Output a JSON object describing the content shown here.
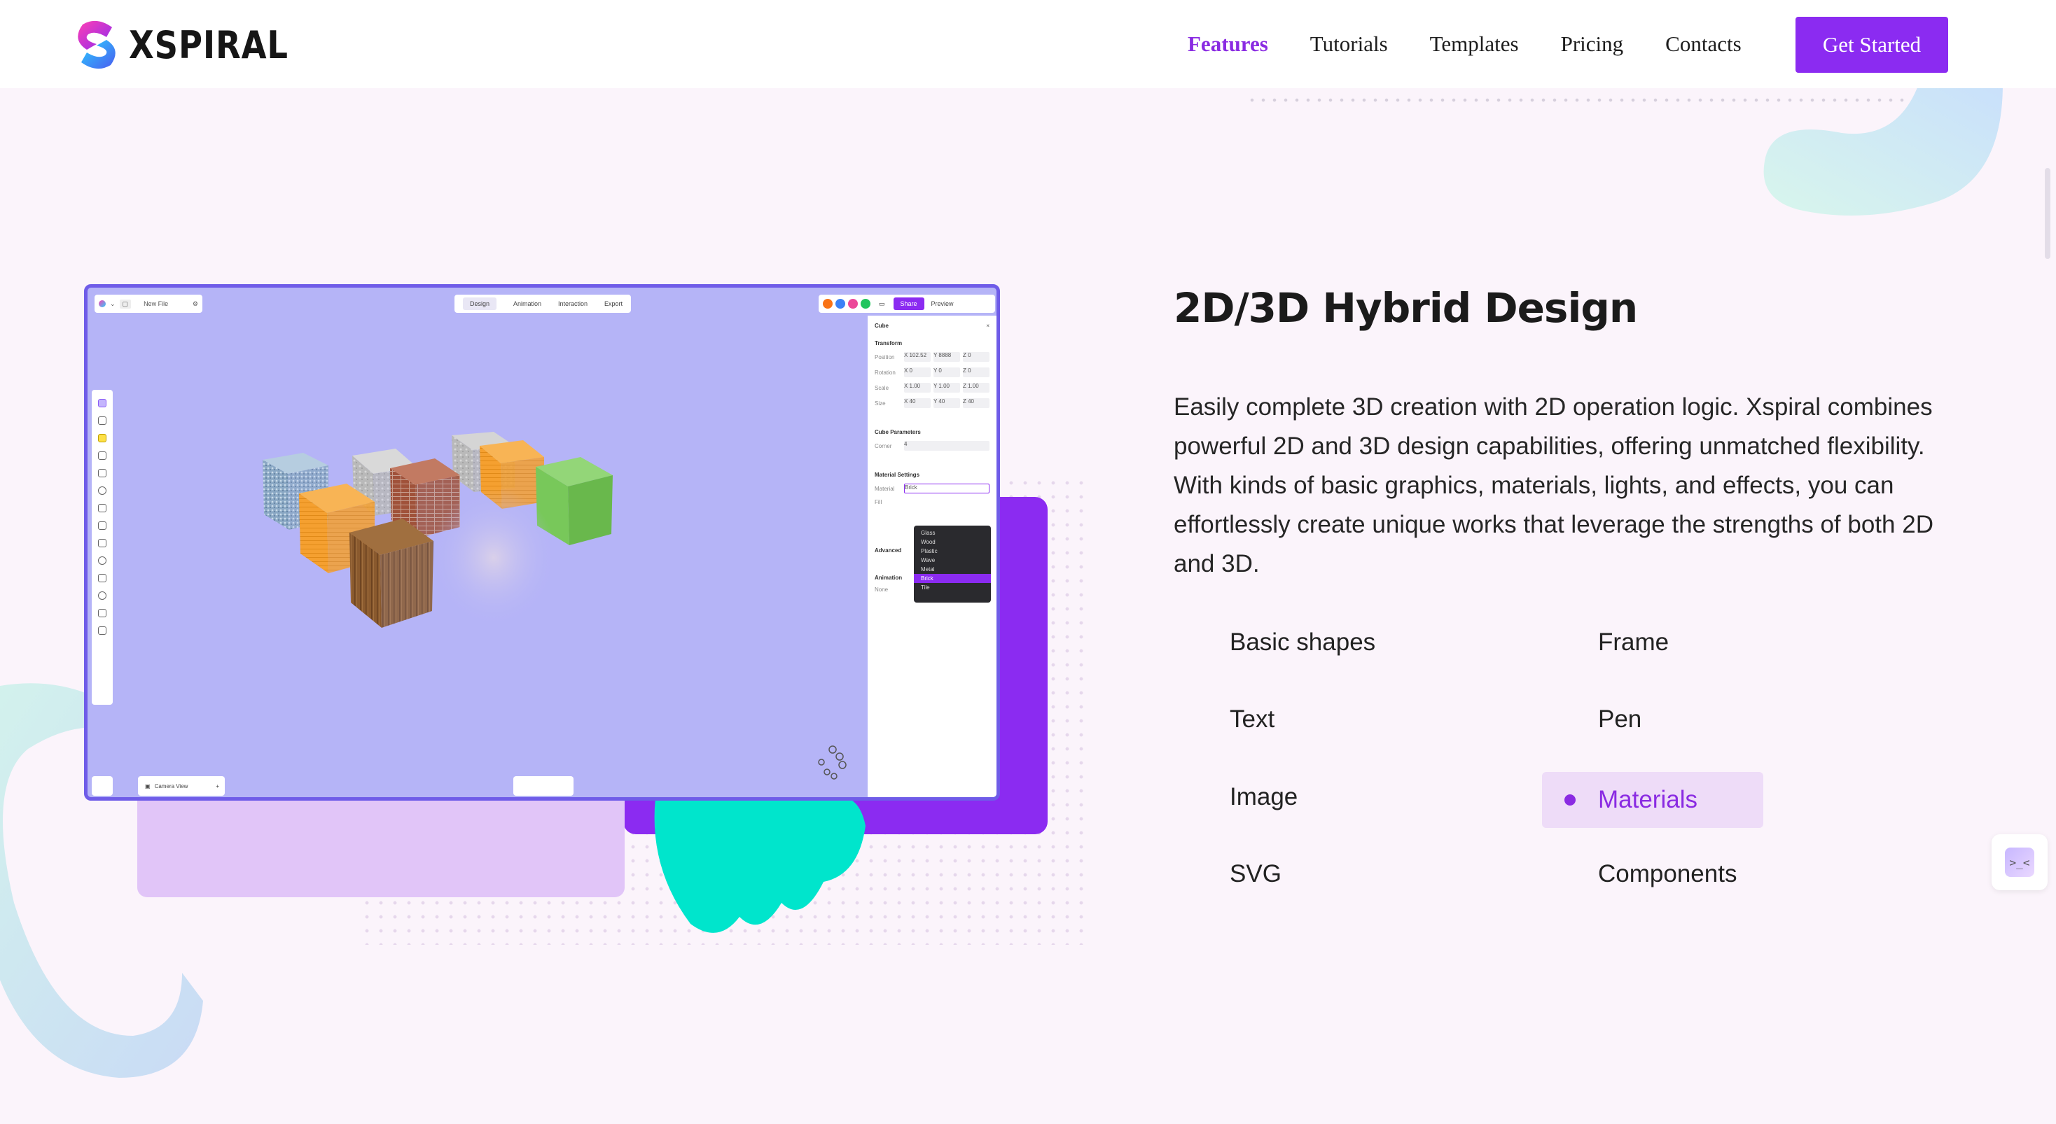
{
  "header": {
    "brand": "XSPIRAL",
    "nav": [
      "Features",
      "Tutorials",
      "Templates",
      "Pricing",
      "Contacts"
    ],
    "cta": "Get Started"
  },
  "app": {
    "file_name": "New File",
    "tabs": [
      "Design",
      "Animation",
      "Interaction",
      "Export"
    ],
    "share": "Share",
    "preview": "Preview",
    "camera_view": "Camera View",
    "properties": {
      "object": "Cube",
      "transform": "Transform",
      "rows": [
        {
          "label": "Position",
          "values": [
            "X 102.52",
            "Y 8888",
            "Z 0"
          ]
        },
        {
          "label": "Rotation",
          "values": [
            "X 0",
            "Y 0",
            "Z 0"
          ]
        },
        {
          "label": "Scale",
          "values": [
            "X 1.00",
            "Y 1.00",
            "Z 1.00"
          ]
        },
        {
          "label": "Size",
          "values": [
            "X 40",
            "Y 40",
            "Z 40"
          ]
        }
      ],
      "cube_parameters": "Cube Parameters",
      "corner_label": "Corner",
      "corner_value": "4",
      "material_settings": "Material Settings",
      "material_label": "Material",
      "material_value": "Brick",
      "fill_label": "Fill",
      "advanced": "Advanced",
      "animation": "Animation",
      "animation_value": "None"
    },
    "material_options": [
      "Glass",
      "Wood",
      "Plastic",
      "Wave",
      "Metal",
      "Brick",
      "Tile"
    ],
    "selected_material": "Brick",
    "colors": {
      "accent": "#8b2bf1",
      "canvas": "#b5b4f7",
      "cube_wood": "#8a5a2e",
      "cube_orange": "#f5a030",
      "cube_green": "#78c85a",
      "cube_brick": "#a0523a",
      "cube_stone": "#b9b9b9",
      "cube_denim": "#8aa8c4"
    }
  },
  "section": {
    "title": "2D/3D Hybrid Design",
    "description": "Easily complete 3D creation with 2D operation logic. Xspiral combines powerful 2D and 3D design capabilities, offering unmatched flexibility. With kinds of basic graphics, materials, lights, and effects, you can effortlessly create unique works that leverage the strengths of both 2D and 3D.",
    "features": [
      "Basic shapes",
      "Frame",
      "Text",
      "Pen",
      "Image",
      "Materials",
      "SVG",
      "Components"
    ],
    "active_feature": "Materials"
  },
  "side_widget_icon": "terminal-collapse-icon",
  "theme": {
    "brand_purple": "#8b2bf1",
    "active_text": "#8a2be2",
    "page_bg": "#fbf4fb",
    "highlight_bg": "#eedcf8",
    "teal": "#00e5cc",
    "lilac": "#e1c5f8"
  }
}
